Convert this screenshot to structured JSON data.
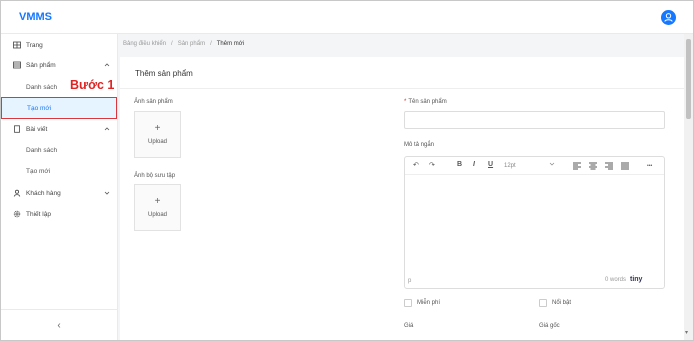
{
  "header": {
    "app_name": "VMMS",
    "avatar_icon": "user-icon"
  },
  "sidebar": {
    "home": {
      "label": "Trang",
      "icon": "grid-icon"
    },
    "products": {
      "label": "Sản phẩm",
      "icon": "table-icon",
      "children": [
        {
          "label": "Danh sách"
        },
        {
          "label": "Tạo mới"
        }
      ]
    },
    "posts": {
      "label": "Bài viết",
      "icon": "document-icon",
      "children": [
        {
          "label": "Danh sách"
        },
        {
          "label": "Tạo mới"
        }
      ]
    },
    "customers": {
      "label": "Khách hàng",
      "icon": "user-icon"
    },
    "settings": {
      "label": "Thiết lập",
      "icon": "gear-icon"
    },
    "collapse_label": "‹"
  },
  "annotation": {
    "step_label": "Bước 1",
    "color": "#e02424"
  },
  "breadcrumb": {
    "items": [
      "Bảng điều khiển",
      "Sản phẩm",
      "Thêm mới"
    ],
    "separator": "/"
  },
  "form": {
    "title": "Thêm sản phẩm",
    "product_image_label": "Ảnh sản phẩm",
    "collection_image_label": "Ảnh bộ sưu tập",
    "upload_label": "Upload",
    "upload_plus": "+",
    "name_label": "Tên sản phẩm",
    "name_required_mark": "*",
    "name_value": "",
    "short_desc_label": "Mô tả ngắn",
    "free_label": "Miễn phí",
    "featured_label": "Nổi bật",
    "price_label": "Giá",
    "original_price_label": "Giá gốc"
  },
  "editor": {
    "font_size": "12pt",
    "undo": "↶",
    "redo": "↷",
    "bold": "B",
    "italic": "I",
    "underline": "U",
    "more": "•••",
    "status_path": "p",
    "word_count": "0 words",
    "brand": "tiny"
  },
  "colors": {
    "accent": "#1677ff",
    "active_bg": "#e6f4ff",
    "danger": "#e02424"
  }
}
